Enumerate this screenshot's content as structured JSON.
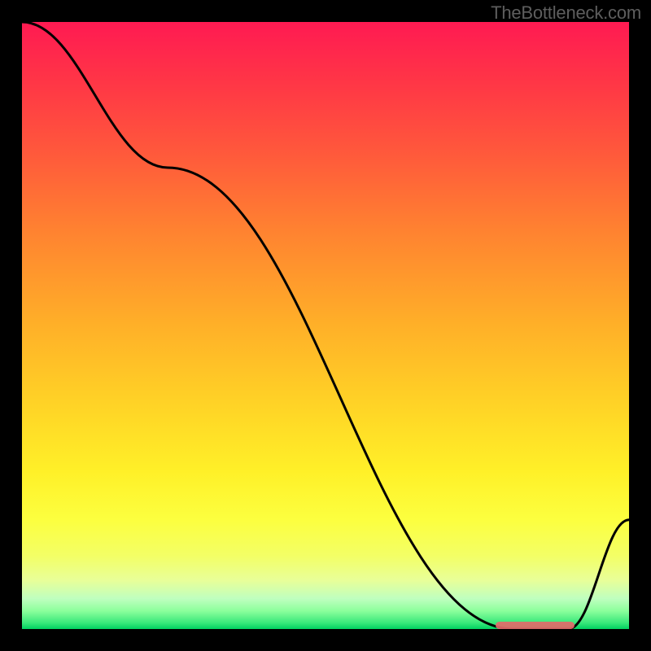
{
  "watermark": "TheBottleneck.com",
  "chart_data": {
    "type": "line",
    "title": "",
    "xlabel": "",
    "ylabel": "",
    "xlim": [
      0,
      100
    ],
    "ylim": [
      0,
      100
    ],
    "series": [
      {
        "name": "curve",
        "x": [
          0,
          24,
          81,
          90,
          100
        ],
        "values": [
          100,
          76,
          0,
          0,
          18
        ]
      }
    ],
    "highlight_range": {
      "x_start": 78,
      "x_end": 91,
      "y": 0.5
    },
    "background_gradient": {
      "stops": [
        {
          "pos": 0,
          "color": "#ff1a52"
        },
        {
          "pos": 50,
          "color": "#ffb028"
        },
        {
          "pos": 82,
          "color": "#fcff3f"
        },
        {
          "pos": 100,
          "color": "#00d060"
        }
      ]
    }
  }
}
